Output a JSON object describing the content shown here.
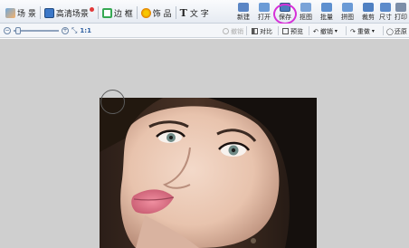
{
  "top_tabs": [
    {
      "label": "场 景",
      "icon": "scene-icon"
    },
    {
      "label": "高清场景",
      "icon": "hd-scene-icon"
    },
    {
      "label": "边 框",
      "icon": "frame-icon"
    },
    {
      "label": "饰 品",
      "icon": "accessory-icon"
    },
    {
      "label": "文 字",
      "icon": "text-icon"
    }
  ],
  "right_tools": [
    {
      "label": "新建",
      "icon": "new-icon"
    },
    {
      "label": "打开",
      "icon": "open-folder-icon"
    },
    {
      "label": "保存",
      "icon": "save-icon",
      "highlighted": true
    },
    {
      "label": "抠图",
      "icon": "cutout-icon"
    },
    {
      "label": "批量",
      "icon": "batch-icon"
    },
    {
      "label": "拼图",
      "icon": "collage-icon"
    },
    {
      "label": "裁剪",
      "icon": "crop-icon"
    },
    {
      "label": "尺寸",
      "icon": "resize-icon"
    },
    {
      "label": "打印",
      "icon": "print-icon"
    }
  ],
  "toolbar2": {
    "zoom_ratio_label": "1:1",
    "undo_history_label": "撤销",
    "compare_label": "对比",
    "preview_label": "预览",
    "undo_label": "撤销",
    "redo_label": "重做",
    "restore_label": "还原"
  },
  "colors": {
    "highlight_ring": "#d630d8",
    "canvas_bg": "#cfcfcf",
    "toolbar_bg": "#e6ebf2"
  }
}
